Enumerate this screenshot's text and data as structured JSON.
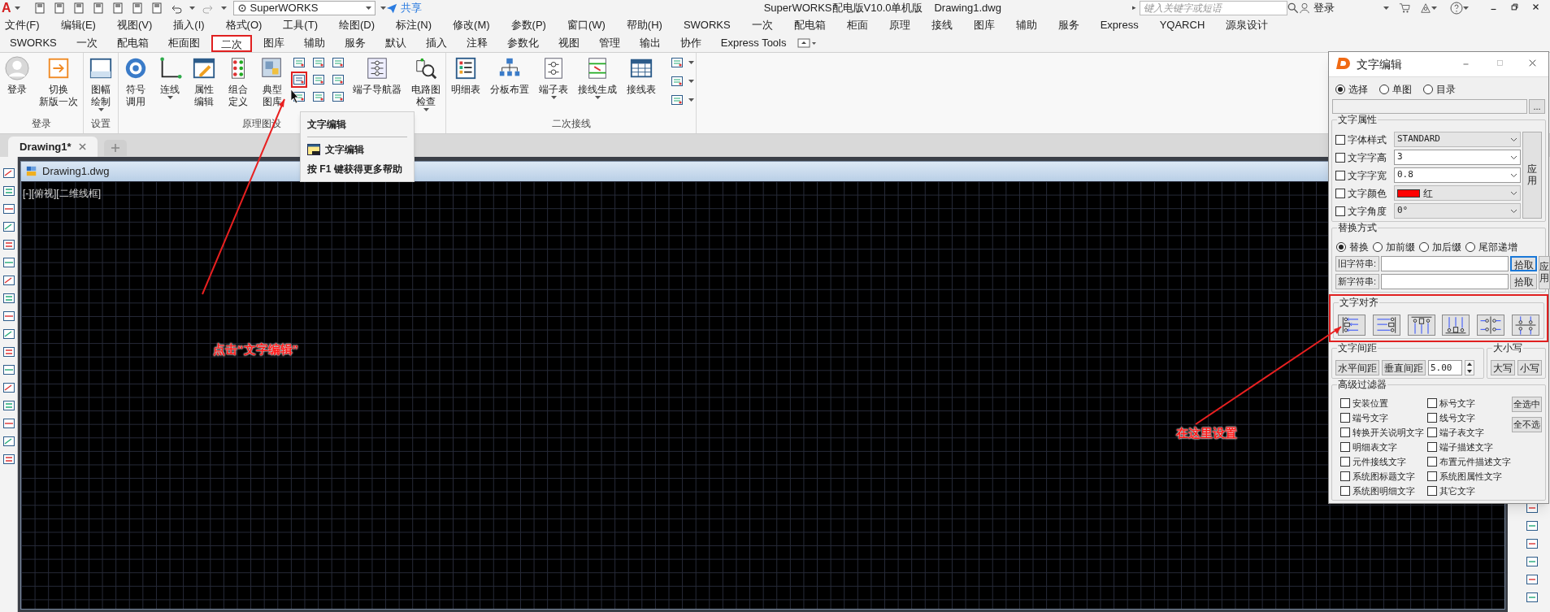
{
  "title_bar": {
    "logo": "A",
    "workspace": "SuperWORKS",
    "share": "共享",
    "search_arrow": "▸",
    "title": "SuperWORKS配电版V10.0单机版",
    "file": "Drawing1.dwg",
    "search": {
      "placeholder": "键入关键字或短语"
    },
    "login": "登录"
  },
  "menu": [
    "文件(F)",
    "编辑(E)",
    "视图(V)",
    "插入(I)",
    "格式(O)",
    "工具(T)",
    "绘图(D)",
    "标注(N)",
    "修改(M)",
    "参数(P)",
    "窗口(W)",
    "帮助(H)",
    "SWORKS",
    "一次",
    "配电箱",
    "柜面",
    "原理",
    "接线",
    "图库",
    "辅助",
    "服务",
    "Express",
    "YQARCH",
    "源泉设计"
  ],
  "ribbon_tabs": [
    {
      "label": "SWORKS",
      "selected": false
    },
    {
      "label": "一次",
      "selected": false
    },
    {
      "label": "配电箱",
      "selected": false
    },
    {
      "label": "柜面图",
      "selected": false
    },
    {
      "label": "二次",
      "selected": true
    },
    {
      "label": "图库",
      "selected": false
    },
    {
      "label": "辅助",
      "selected": false
    },
    {
      "label": "服务",
      "selected": false
    },
    {
      "label": "默认",
      "selected": false
    },
    {
      "label": "插入",
      "selected": false
    },
    {
      "label": "注释",
      "selected": false
    },
    {
      "label": "参数化",
      "selected": false
    },
    {
      "label": "视图",
      "selected": false
    },
    {
      "label": "管理",
      "selected": false
    },
    {
      "label": "输出",
      "selected": false
    },
    {
      "label": "协作",
      "selected": false
    },
    {
      "label": "Express Tools",
      "selected": false
    }
  ],
  "ribbon_groups": [
    {
      "label": "登录",
      "items": [
        {
          "kind": "large",
          "label": "登录",
          "has_menu": false
        },
        {
          "kind": "large",
          "label": [
            "切换",
            "新版一次"
          ],
          "has_menu": false
        }
      ]
    },
    {
      "label": "设置",
      "items": [
        {
          "kind": "large",
          "label": [
            "图幅",
            "绘制"
          ],
          "has_menu": true
        }
      ]
    },
    {
      "label": "原理图设",
      "items": [
        {
          "kind": "large",
          "label": [
            "符号",
            "调用"
          ],
          "has_menu": false
        },
        {
          "kind": "large",
          "label": "连线",
          "has_menu": true
        },
        {
          "kind": "large",
          "label": [
            "属性",
            "编辑"
          ],
          "has_menu": false
        },
        {
          "kind": "large",
          "label": [
            "组合",
            "定义"
          ],
          "has_menu": false
        },
        {
          "kind": "large",
          "label": [
            "典型",
            "图库"
          ],
          "has_menu": false
        },
        {
          "kind": "cluster"
        },
        {
          "kind": "large",
          "label": "端子导航器",
          "has_menu": false
        },
        {
          "kind": "large",
          "label": [
            "电路图",
            "检查"
          ],
          "has_menu": true
        }
      ]
    },
    {
      "label": "二次接线",
      "items": [
        {
          "kind": "large",
          "label": "明细表",
          "has_menu": false
        },
        {
          "kind": "large",
          "label": "分板布置",
          "has_menu": false
        },
        {
          "kind": "large",
          "label": "端子表",
          "has_menu": true
        },
        {
          "kind": "large",
          "label": "接线生成",
          "has_menu": true
        },
        {
          "kind": "large",
          "label": "接线表",
          "has_menu": false
        },
        {
          "kind": "column"
        }
      ]
    }
  ],
  "tooltip": {
    "title": "文字编辑",
    "command": "文字编辑",
    "help": "按 F1 键获得更多帮助"
  },
  "doc_tabs": [
    {
      "label": "Drawing1*",
      "selected": true
    }
  ],
  "drawing_window": {
    "title": "Drawing1.dwg",
    "viewport_label": "[-][俯视][二维线框]"
  },
  "annotations": [
    {
      "text": "点击“文字编辑”"
    },
    {
      "text": "在这里设置"
    }
  ],
  "dialog": {
    "title": "文字编辑",
    "scope": [
      {
        "label": "选择",
        "selected": true
      },
      {
        "label": "单图",
        "selected": false
      },
      {
        "label": "目录",
        "selected": false
      }
    ],
    "browse": "...",
    "properties": {
      "title": "文字属性",
      "apply": "应用",
      "rows": [
        {
          "label": "字体样式",
          "checked": false,
          "value": "STANDARD",
          "disabled": true
        },
        {
          "label": "文字字高",
          "checked": false,
          "value": "3",
          "disabled": false
        },
        {
          "label": "文字字宽",
          "checked": false,
          "value": "0.8",
          "disabled": false
        },
        {
          "label": "文字颜色",
          "checked": false,
          "value": "红",
          "color": "#ff0000",
          "disabled": true
        },
        {
          "label": "文字角度",
          "checked": false,
          "value": "0°",
          "disabled": true
        }
      ]
    },
    "replace": {
      "title": "替换方式",
      "apply": "应用",
      "modes": [
        {
          "label": "替换",
          "selected": true
        },
        {
          "label": "加前缀",
          "selected": false
        },
        {
          "label": "加后缀",
          "selected": false
        },
        {
          "label": "尾部递增",
          "selected": false
        }
      ],
      "fields": [
        {
          "label": "旧字符串:",
          "pick": "拾取",
          "focused": true
        },
        {
          "label": "新字符串:",
          "pick": "拾取",
          "focused": false
        }
      ]
    },
    "align": {
      "title": "文字对齐",
      "buttons": [
        {
          "kind": "left"
        },
        {
          "kind": "right"
        },
        {
          "kind": "top"
        },
        {
          "kind": "bottom"
        },
        {
          "kind": "middle"
        },
        {
          "kind": "center"
        }
      ]
    },
    "spacing": {
      "title": "文字间距",
      "buttons": [
        "水平间距",
        "垂直间距"
      ],
      "value": "5.00"
    },
    "case": {
      "title": "大小写",
      "buttons": [
        "大写",
        "小写"
      ]
    },
    "filter": {
      "title": "高级过滤器",
      "select_all": "全选中",
      "select_none": "全不选",
      "left": [
        {
          "label": "安装位置",
          "checked": false
        },
        {
          "label": "端号文字",
          "checked": false
        },
        {
          "label": "转换开关说明文字",
          "checked": false
        },
        {
          "label": "明细表文字",
          "checked": false
        },
        {
          "label": "元件接线文字",
          "checked": false
        },
        {
          "label": "系统图标题文字",
          "checked": false
        },
        {
          "label": "系统图明细文字",
          "checked": false
        }
      ],
      "right": [
        {
          "label": "标号文字",
          "checked": false
        },
        {
          "label": "线号文字",
          "checked": false
        },
        {
          "label": "端子表文字",
          "checked": false
        },
        {
          "label": "端子描述文字",
          "checked": false
        },
        {
          "label": "布置元件描述文字",
          "checked": false
        },
        {
          "label": "系统图属性文字",
          "checked": false
        },
        {
          "label": "其它文字",
          "checked": false
        }
      ]
    }
  }
}
